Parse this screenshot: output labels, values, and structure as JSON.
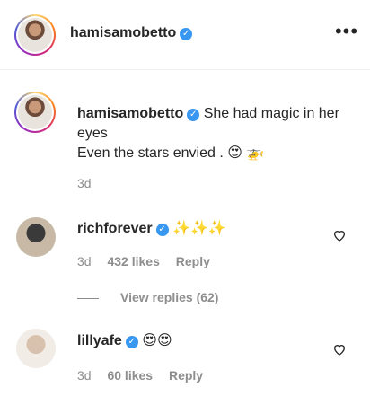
{
  "header": {
    "username": "hamisamobetto",
    "more_label": "•••"
  },
  "caption": {
    "username": "hamisamobetto",
    "text_line1": "She had magic in her eyes",
    "text_line2": "Even the stars envied .",
    "emojis": "😍 🚁",
    "time": "3d"
  },
  "comments": [
    {
      "username": "richforever",
      "text": "✨✨✨",
      "time": "3d",
      "likes": "432 likes",
      "reply": "Reply"
    },
    {
      "username": "lillyafe",
      "text": "😍😍",
      "time": "3d",
      "likes": "60 likes",
      "reply": "Reply"
    }
  ],
  "view_replies": "View replies (62)",
  "colors": {
    "verified": "#3897f0",
    "meta": "#8e8e8e",
    "text": "#262626"
  }
}
